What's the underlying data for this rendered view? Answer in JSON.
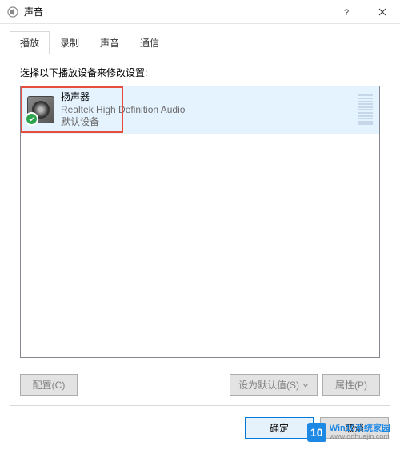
{
  "window": {
    "title": "声音"
  },
  "tabs": [
    {
      "label": "播放",
      "active": true
    },
    {
      "label": "录制",
      "active": false
    },
    {
      "label": "声音",
      "active": false
    },
    {
      "label": "通信",
      "active": false
    }
  ],
  "instruction": "选择以下播放设备来修改设置:",
  "devices": [
    {
      "name": "扬声器",
      "driver": "Realtek High Definition Audio",
      "status": "默认设备",
      "selected": true,
      "default": true
    }
  ],
  "panelButtons": {
    "configure": "配置(C)",
    "setDefault": "设为默认值(S)",
    "properties": "属性(P)"
  },
  "dialogButtons": {
    "ok": "确定",
    "cancel": "取消"
  },
  "watermark": {
    "logo": "10",
    "line1": "Win10系统家园",
    "line2": "www.qdhuajin.com"
  }
}
